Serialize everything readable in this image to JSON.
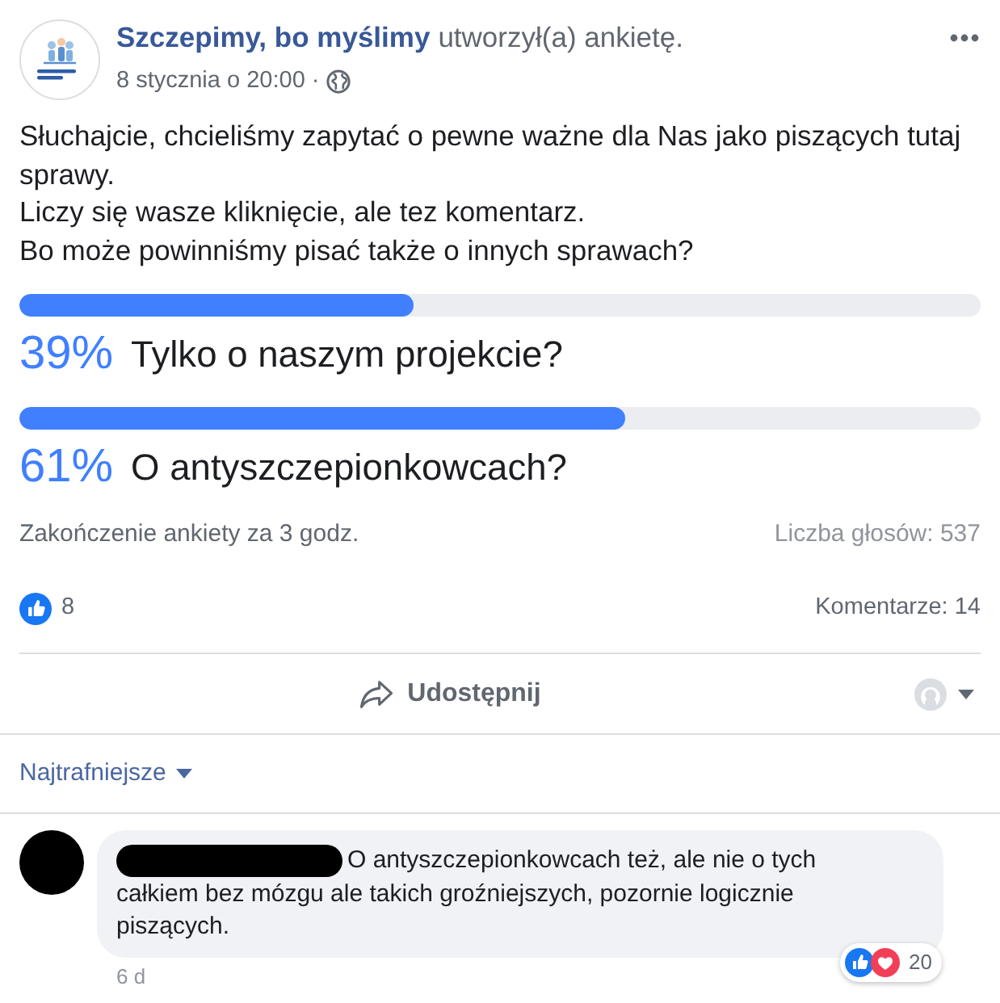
{
  "post": {
    "author": "Szczepimy, bo myślimy",
    "action": "utworzył(a) ankietę.",
    "timestamp": "8 stycznia o 20:00",
    "separator": "·",
    "text": [
      "Słuchajcie, chcieliśmy zapytać o pewne ważne dla Nas jako piszących tutaj sprawy.",
      "Liczy się wasze kliknięcie, ale tez komentarz.",
      "Bo może powinniśmy pisać także o innych sprawach?"
    ]
  },
  "poll": {
    "options": [
      {
        "percent": "39%",
        "label": "Tylko o naszym projekcie?",
        "level": 0.41
      },
      {
        "percent": "61%",
        "label": "O antyszczepionkowcach?",
        "level": 0.63
      }
    ],
    "time_left": "Zakończenie ankiety za 3 godz.",
    "votes": "Liczba głosów: 537"
  },
  "stats": {
    "reactions": "8",
    "comments": "Komentarze: 14"
  },
  "actions": [
    {
      "label": "Udostępnij"
    }
  ],
  "comments": {
    "sort": "Najtrafniejsze",
    "items": [
      {
        "text": "O antyszczepionkowcach też, ale nie o tych całkiem bez mózgu ale takich groźniejszych, pozornie logicznie piszących.",
        "age": "6 d",
        "reactions": "20"
      }
    ]
  }
}
